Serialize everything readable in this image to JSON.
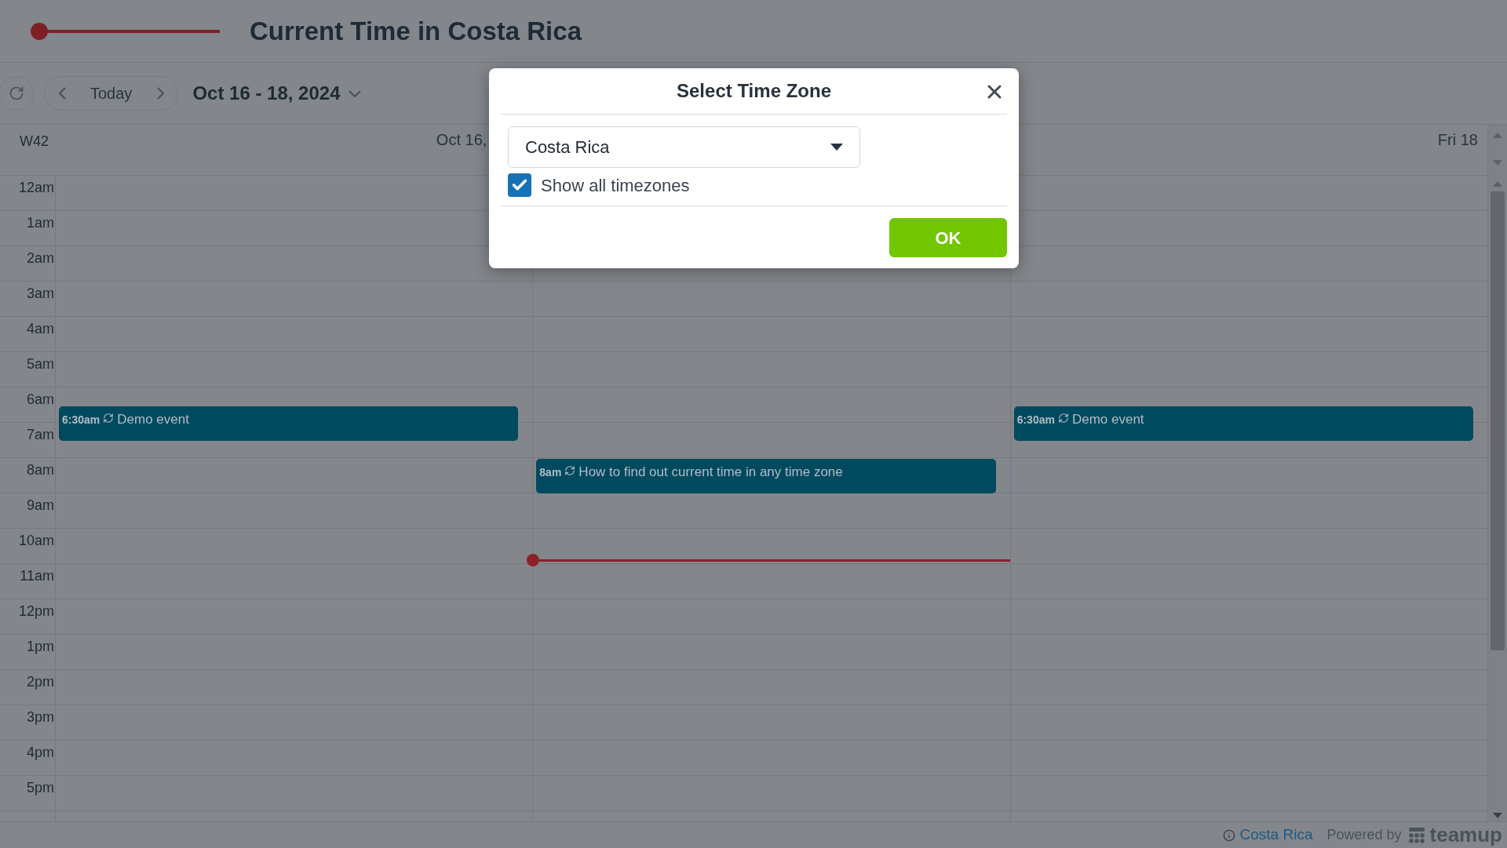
{
  "header": {
    "title": "Current Time in Costa Rica"
  },
  "toolbar": {
    "today": "Today",
    "date_range": "Oct 16 - 18, 2024"
  },
  "calendar": {
    "week_label": "W42",
    "hours": [
      "12am",
      "1am",
      "2am",
      "3am",
      "4am",
      "5am",
      "6am",
      "7am",
      "8am",
      "9am",
      "10am",
      "11am",
      "12pm",
      "1pm",
      "2pm",
      "3pm",
      "4pm",
      "5pm"
    ],
    "days": [
      {
        "header": "Oct 16,",
        "events": [
          {
            "time": "6:30am",
            "title": "Demo event"
          }
        ]
      },
      {
        "events": [
          {
            "time": "8am",
            "title": "How to find out current time in any time zone"
          }
        ],
        "now_marker": true
      },
      {
        "header": "Fri 18",
        "events": [
          {
            "time": "6:30am",
            "title": "Demo event"
          }
        ]
      }
    ]
  },
  "footer": {
    "timezone": "Costa Rica",
    "powered_by": "Powered by",
    "brand": "teamup"
  },
  "dialog": {
    "title": "Select Time Zone",
    "timezone_select": {
      "value": "Costa Rica"
    },
    "show_all": {
      "label": "Show all timezones",
      "checked": true
    },
    "ok": "OK"
  }
}
